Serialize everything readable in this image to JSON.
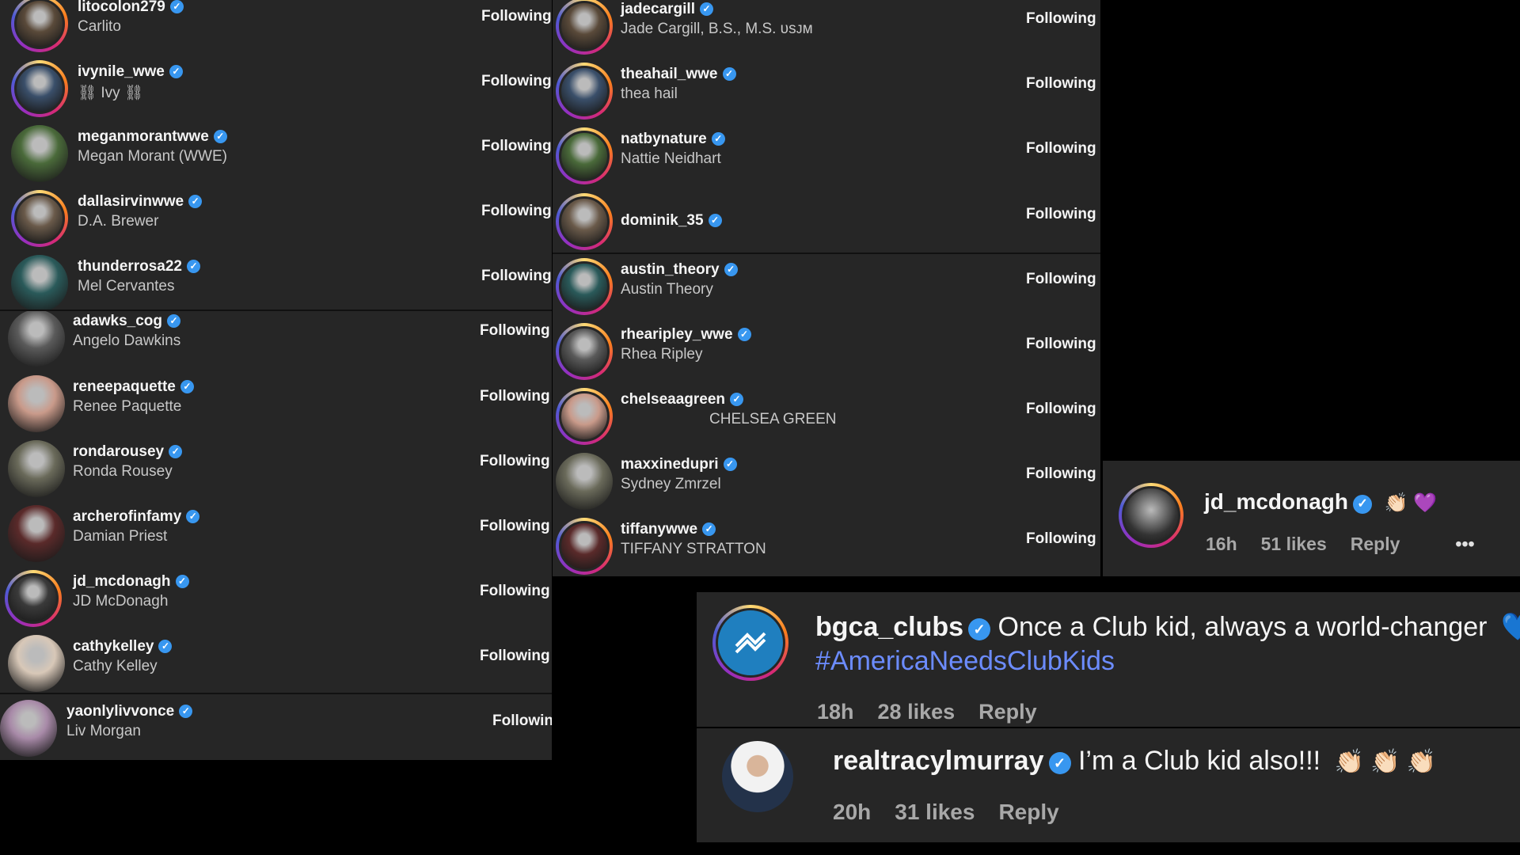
{
  "follow_label": "Following",
  "panel_left": [
    {
      "username": "litocolon279",
      "fullname": "Carlito",
      "follow": "Following"
    },
    {
      "username": "ivynile_wwe",
      "fullname": "⛓ Ivy ⛓",
      "follow": "Following"
    },
    {
      "username": "meganmorantwwe",
      "fullname": "Megan Morant (WWE)",
      "follow": "Following"
    },
    {
      "username": "dallasirvinwwe",
      "fullname": "D.A. Brewer",
      "follow": "Following"
    },
    {
      "username": "thunderrosa22",
      "fullname": "Mel Cervantes",
      "follow": "Following"
    },
    {
      "username": "adawks_cog",
      "fullname": "Angelo Dawkins",
      "follow": "Following"
    },
    {
      "username": "reneepaquette",
      "fullname": "Renee Paquette",
      "follow": "Following"
    },
    {
      "username": "rondarousey",
      "fullname": "Ronda Rousey",
      "follow": "Following"
    },
    {
      "username": "archerofinfamy",
      "fullname": "Damian Priest",
      "follow": "Following"
    },
    {
      "username": "jd_mcdonagh",
      "fullname": "JD McDonagh",
      "follow": "Following"
    },
    {
      "username": "cathykelley",
      "fullname": "Cathy Kelley",
      "follow": "Following"
    },
    {
      "username": "yaonlylivvonce",
      "fullname": "Liv Morgan",
      "follow": "Followin"
    }
  ],
  "panel_mid": [
    {
      "username": "jadecargill",
      "fullname": "Jade Cargill, B.S., M.S. ᴜsᴊᴍ",
      "follow": "Following"
    },
    {
      "username": "theahail_wwe",
      "fullname": "thea hail",
      "follow": "Following"
    },
    {
      "username": "natbynature",
      "fullname": "Nattie Neidhart",
      "follow": "Following"
    },
    {
      "username": "dominik_35",
      "fullname": "",
      "follow": "Following"
    },
    {
      "username": "austin_theory",
      "fullname": "Austin Theory",
      "follow": "Following"
    },
    {
      "username": "rhearipley_wwe",
      "fullname": "Rhea Ripley",
      "follow": "Following"
    },
    {
      "username": "chelseaagreen",
      "fullname": "CHELSEA GREEN",
      "follow": "Following"
    },
    {
      "username": "maxxinedupri",
      "fullname": "Sydney Zmrzel",
      "follow": "Following"
    },
    {
      "username": "tiffanywwe",
      "fullname": "TIFFANY STRATTON",
      "follow": "Following"
    }
  ],
  "comments": {
    "jd": {
      "username": "jd_mcdonagh",
      "emojis": "👏🏻 💜",
      "time": "16h",
      "likes": "51 likes",
      "reply": "Reply",
      "more": "•••"
    },
    "bgca": {
      "username": "bgca_clubs",
      "text": "Once a Club kid, always a world-changer",
      "emoji": "💙",
      "hashtag": "#AmericaNeedsClubKids",
      "time": "18h",
      "likes": "28 likes",
      "reply": "Reply"
    },
    "tracy": {
      "username": "realtracylmurray",
      "text": "I’m a Club kid also!!!",
      "emojis": "👏🏻 👏🏻 👏🏻",
      "time": "20h",
      "likes": "31 likes",
      "reply": "Reply"
    }
  },
  "colors": {
    "panel_bg": "#262626",
    "verified": "#3897f0",
    "hashtag": "#6c8cff",
    "meta": "#a8a8a8"
  }
}
